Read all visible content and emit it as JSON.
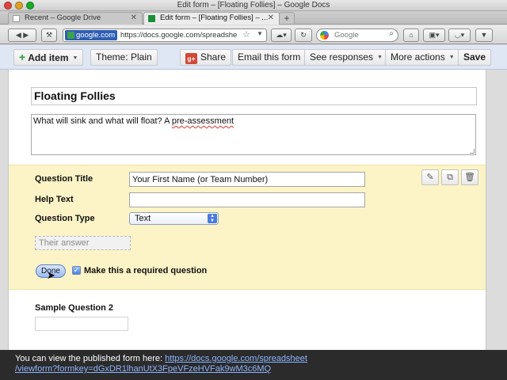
{
  "window": {
    "title": "Edit form – [Floating Follies] – Google Docs"
  },
  "tabs": [
    {
      "label": "Recent – Google Drive"
    },
    {
      "label": "Edit form – [Floating Follies] – ..."
    }
  ],
  "navbar": {
    "site_badge": "google.com",
    "url": "https://docs.google.com/spreadshe",
    "search_placeholder": "Google"
  },
  "toolbar": {
    "add_item": "Add item",
    "theme": "Theme:  Plain",
    "share": "Share",
    "email_form": "Email this form",
    "see_responses": "See responses",
    "more_actions": "More actions",
    "save": "Save"
  },
  "form": {
    "title": "Floating Follies",
    "description_prefix": "What will sink and what will float? A ",
    "description_misspelled": "pre-assessment"
  },
  "question_editor": {
    "title_label": "Question Title",
    "title_value": "Your First Name (or Team Number)",
    "help_label": "Help Text",
    "help_value": "",
    "type_label": "Question Type",
    "type_value": "Text",
    "answer_placeholder": "Their answer",
    "done": "Done",
    "required_label": "Make this a required question",
    "required_checked": true
  },
  "sample_question": {
    "label": "Sample Question 2"
  },
  "notice": {
    "text": "You can view the published form here: ",
    "link_line1": "https://docs.google.com/spreadsheet",
    "link_line2": "/viewform?formkey=dGxDR1lhanUtX3FpeVFzeHVFak9wM3c6MQ"
  },
  "colors": {
    "editor_highlight": "#fcf4c6",
    "toolbar_bg": "#dfe6f4",
    "notice_bg": "#2b2b2b",
    "link": "#8db4ff"
  }
}
